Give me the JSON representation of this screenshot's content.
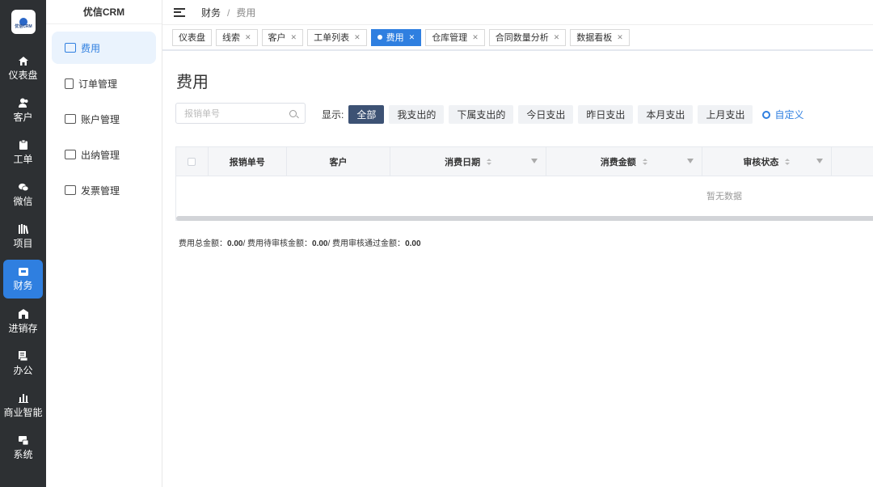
{
  "app": {
    "brand": "优信CRM",
    "logo_text": "优信CRM"
  },
  "rail": [
    {
      "label": "仪表盘",
      "icon": "home-icon"
    },
    {
      "label": "客户",
      "icon": "users-icon"
    },
    {
      "label": "工单",
      "icon": "clipboard-icon"
    },
    {
      "label": "微信",
      "icon": "wechat-icon"
    },
    {
      "label": "项目",
      "icon": "books-icon"
    },
    {
      "label": "财务",
      "icon": "wallet-icon",
      "active": true
    },
    {
      "label": "进销存",
      "icon": "warehouse-icon"
    },
    {
      "label": "办公",
      "icon": "briefcase-icon"
    },
    {
      "label": "商业智能",
      "icon": "bar-chart-icon"
    },
    {
      "label": "系统",
      "icon": "system-icon"
    }
  ],
  "sidebar": {
    "items": [
      {
        "label": "费用",
        "active": true
      },
      {
        "label": "订单管理"
      },
      {
        "label": "账户管理"
      },
      {
        "label": "出纳管理"
      },
      {
        "label": "发票管理"
      }
    ]
  },
  "breadcrumb": {
    "parent": "财务",
    "separator": "/",
    "current": "费用"
  },
  "tabs": [
    {
      "label": "仪表盘",
      "closable": false
    },
    {
      "label": "线索",
      "closable": true
    },
    {
      "label": "客户",
      "closable": true
    },
    {
      "label": "工单列表",
      "closable": true
    },
    {
      "label": "费用",
      "closable": true,
      "active": true
    },
    {
      "label": "仓库管理",
      "closable": true
    },
    {
      "label": "合同数量分析",
      "closable": true
    },
    {
      "label": "数据看板",
      "closable": true
    }
  ],
  "page": {
    "title": "费用"
  },
  "search": {
    "placeholder": "报销单号"
  },
  "filters": {
    "show_label": "显示:",
    "options": [
      "全部",
      "我支出的",
      "下属支出的",
      "今日支出",
      "昨日支出",
      "本月支出",
      "上月支出"
    ],
    "active_index": 0,
    "custom_label": "自定义"
  },
  "table": {
    "columns": [
      "报销单号",
      "客户",
      "消费日期",
      "消费金额",
      "审核状态"
    ],
    "empty_text": "暂无数据"
  },
  "summary": {
    "total_label": "费用总金额：",
    "total_value": "0.00",
    "pending_label": "/ 费用待审核金额：",
    "pending_value": "0.00",
    "approved_label": "/ 费用审核通过金额：",
    "approved_value": "0.00"
  },
  "colors": {
    "accent": "#2f7fe0",
    "rail_bg": "#2d3033",
    "filter_active": "#3d5274"
  }
}
